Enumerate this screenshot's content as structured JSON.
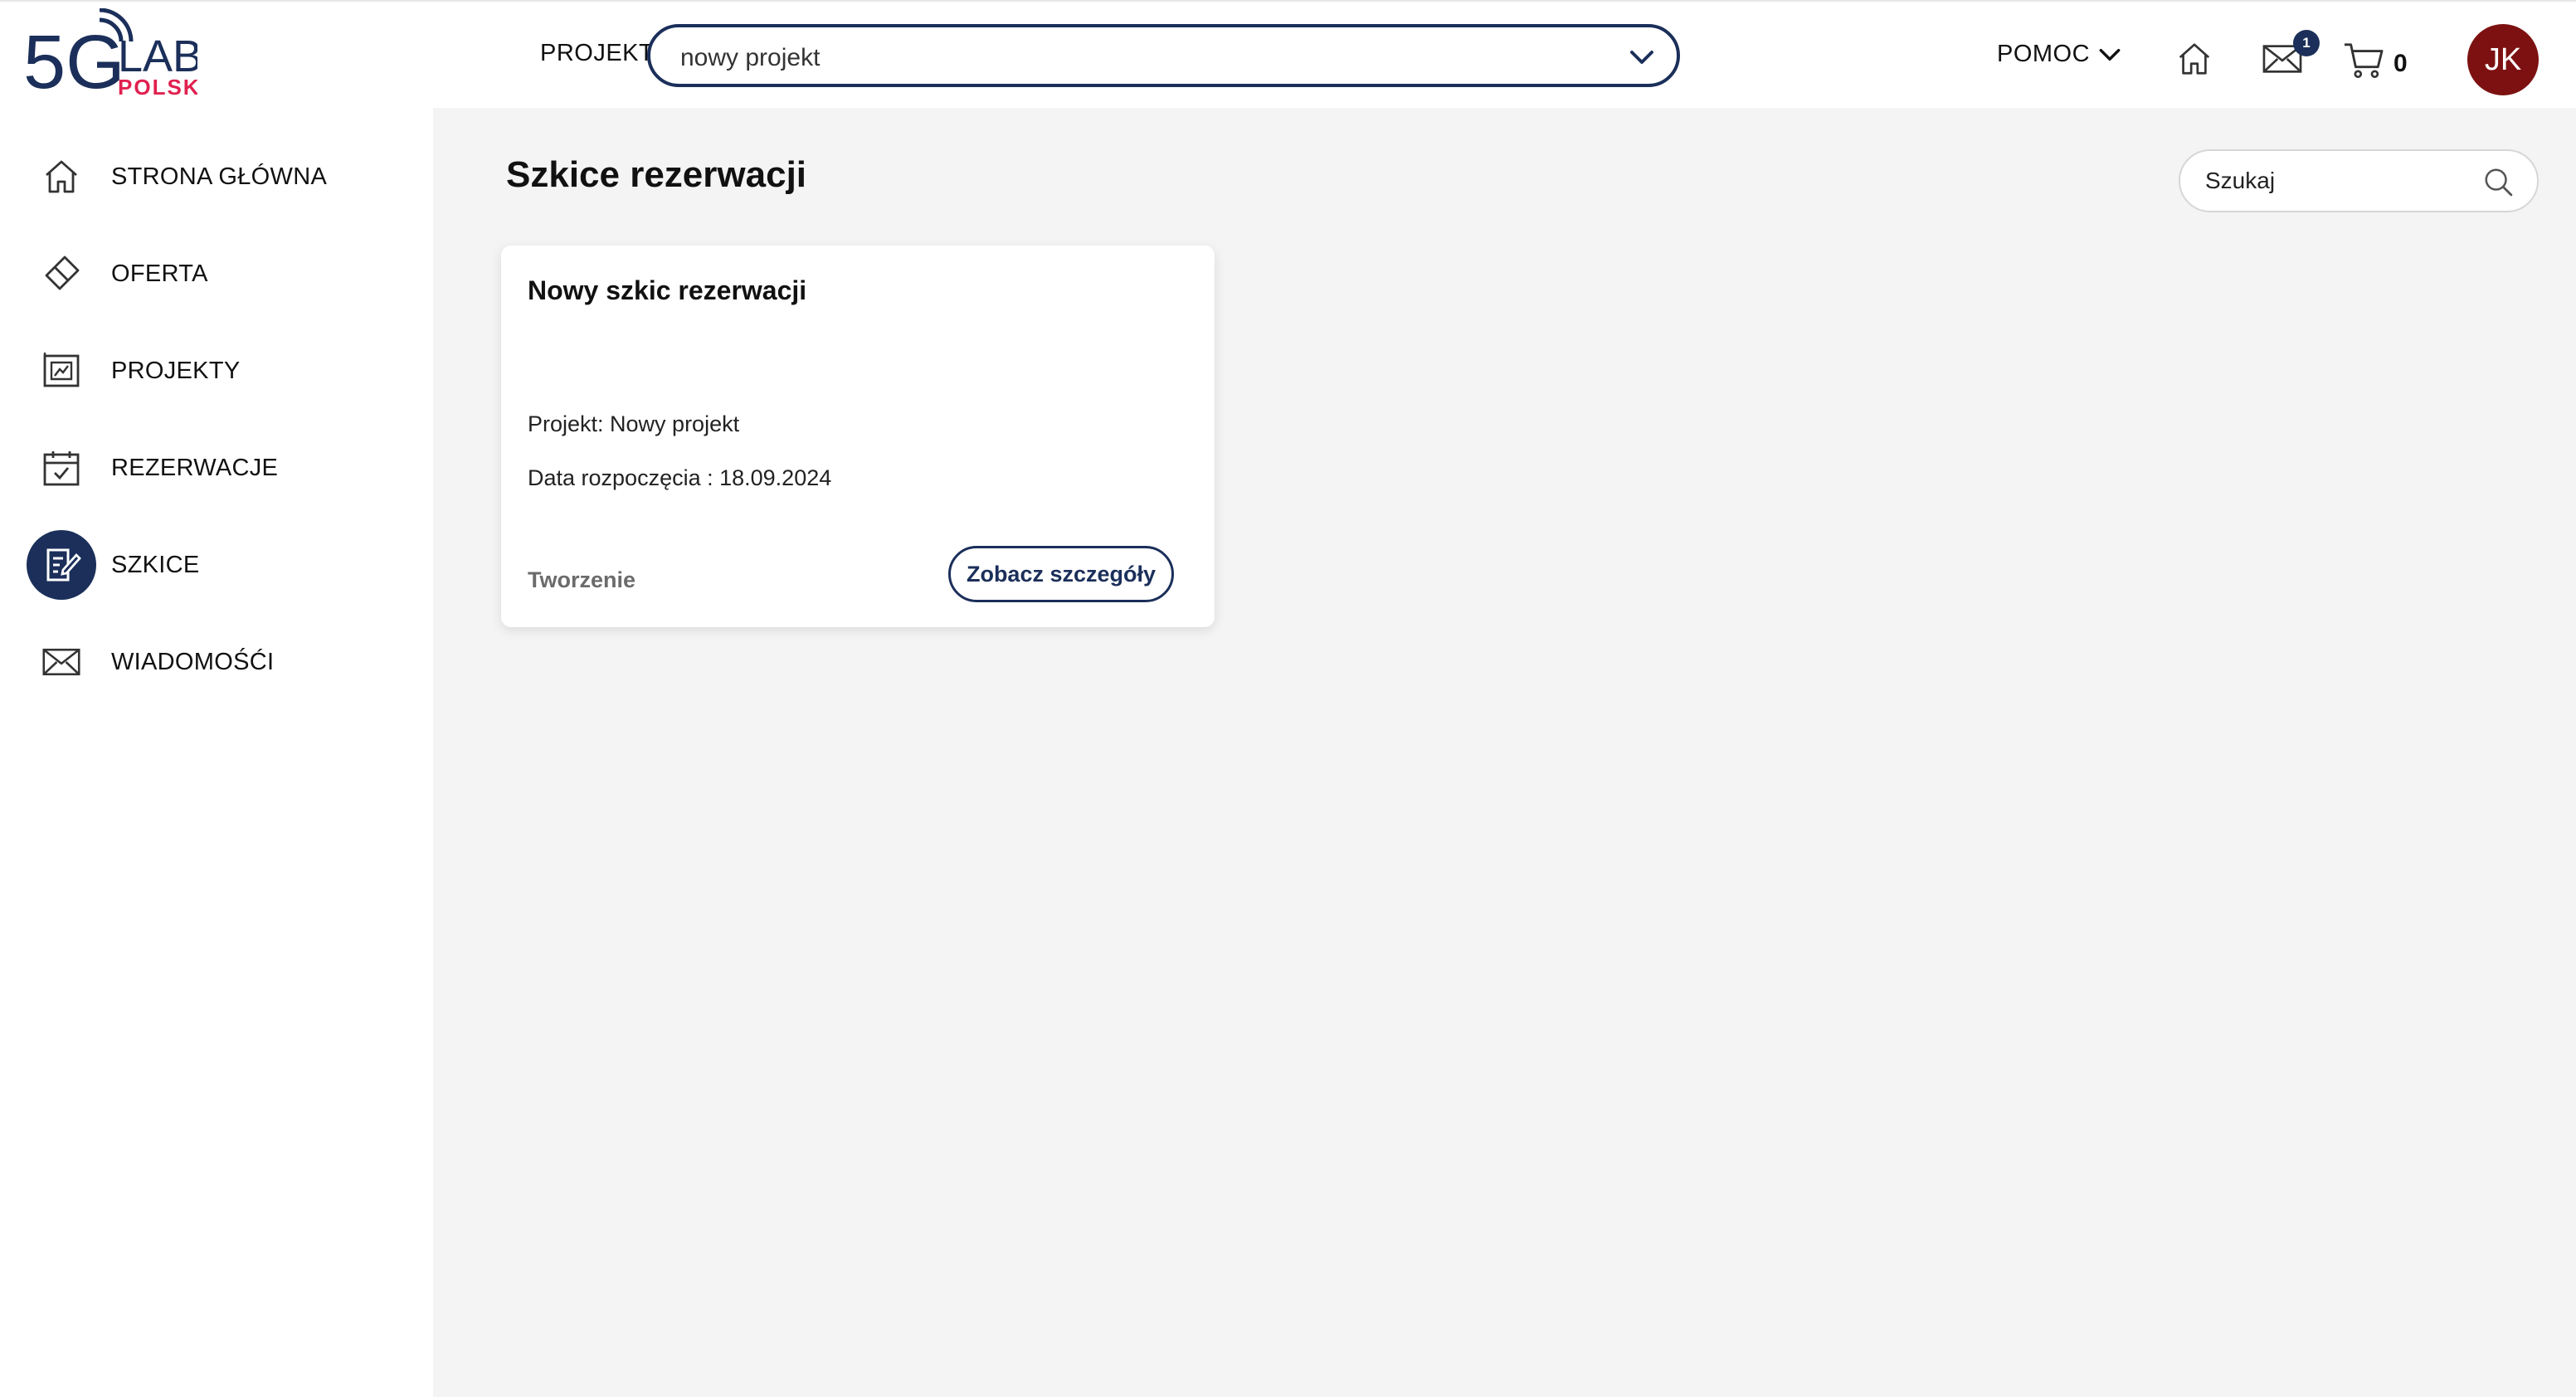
{
  "logo": {
    "main": "5G",
    "lab": "LAB",
    "sub": "POLSKA"
  },
  "header": {
    "project_label": "PROJEKT",
    "project_value": "nowy projekt",
    "help_label": "POMOC",
    "mail_badge": "1",
    "cart_count": "0",
    "avatar_initials": "JK"
  },
  "sidebar": {
    "items": [
      {
        "label": "STRONA GŁÓWNA",
        "icon": "home-icon"
      },
      {
        "label": "OFERTA",
        "icon": "tag-icon"
      },
      {
        "label": "PROJEKTY",
        "icon": "projects-icon"
      },
      {
        "label": "REZERWACJE",
        "icon": "calendar-check-icon"
      },
      {
        "label": "SZKICE",
        "icon": "draft-edit-icon",
        "active": true
      },
      {
        "label": "WIADOMOŚĆI",
        "icon": "envelope-icon"
      }
    ]
  },
  "main": {
    "title": "Szkice rezerwacji",
    "search_placeholder": "Szukaj",
    "card": {
      "title": "Nowy szkic rezerwacji",
      "project_line": "Projekt: Nowy projekt",
      "date_line": "Data rozpoczęcia : 18.09.2024",
      "status": "Tworzenie",
      "details_button": "Zobacz szczegóły"
    }
  },
  "colors": {
    "brand_navy": "#1b2f5a",
    "logo_red": "#e0214f",
    "avatar_bg": "#7d1111",
    "main_bg": "#f4f4f4"
  }
}
